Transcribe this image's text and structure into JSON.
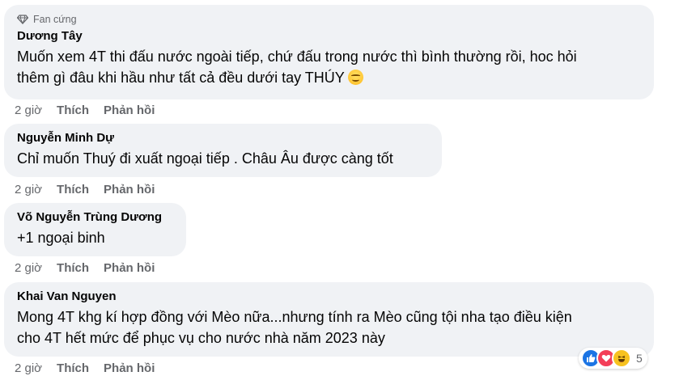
{
  "comments": [
    {
      "badge": "Fan cứng",
      "author": "Dương Tây",
      "lines": [
        "Muốn xem 4T thi đấu nước ngoài tiếp, chứ đấu trong nước thì bình thường rồi, hoc hỏi",
        "thêm gì đâu khi hầu như tất cả đều dưới tay THÚY"
      ],
      "has_emoji": true,
      "emoji": "smiling-face-emoji",
      "time": "2 giờ",
      "like": "Thích",
      "reply": "Phản hồi"
    },
    {
      "author": "Nguyễn Minh Dự",
      "lines": [
        "Chỉ muốn Thuý đi xuất ngoại tiếp . Châu Âu được càng tốt"
      ],
      "time": "2 giờ",
      "like": "Thích",
      "reply": "Phản hồi"
    },
    {
      "author": "Võ Nguyễn Trùng Dương",
      "lines": [
        "+1 ngoại binh"
      ],
      "time": "2 giờ",
      "like": "Thích",
      "reply": "Phản hồi"
    },
    {
      "author": "Khai Van Nguyen",
      "lines": [
        "Mong 4T khg kí hợp đồng với Mèo nữa...nhưng tính ra Mèo cũng tội nha tạo điều kiện",
        "cho 4T hết mức để phục vụ cho nước nhà năm 2023 này"
      ],
      "time": "2 giờ",
      "like": "Thích",
      "reply": "Phản hồi",
      "reactions": {
        "icons": [
          "like-reaction-icon",
          "love-reaction-icon",
          "haha-reaction-icon"
        ],
        "count": "5"
      }
    }
  ],
  "colors": {
    "bubble": "#f0f2f5",
    "meta": "#65676b",
    "text": "#050505",
    "like_blue": "#1b74e4",
    "love_red": "#f33e58",
    "haha_yellow": "#f7c21f"
  }
}
